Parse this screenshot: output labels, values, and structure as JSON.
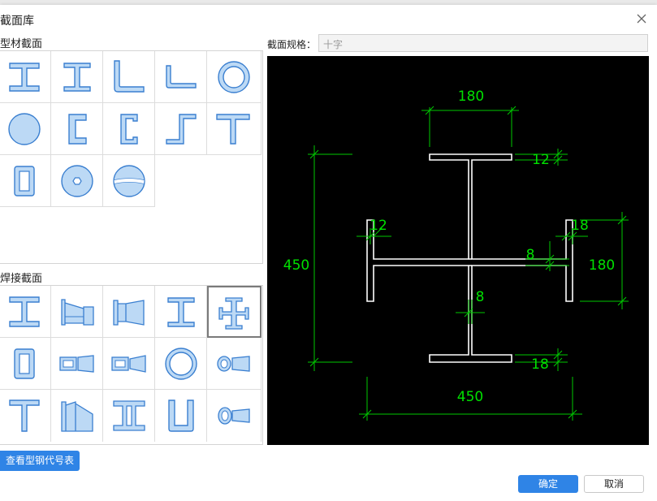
{
  "dialog": {
    "title": "截面库",
    "close_icon": "close-icon"
  },
  "profile_section": {
    "label": "型材截面",
    "items": [
      {
        "icon": "i-beam-icon"
      },
      {
        "icon": "h-beam-icon"
      },
      {
        "icon": "unequal-angle-icon"
      },
      {
        "icon": "equal-angle-icon"
      },
      {
        "icon": "circular-tube-icon"
      },
      {
        "icon": "solid-round-icon"
      },
      {
        "icon": "channel-icon"
      },
      {
        "icon": "lipped-channel-icon"
      },
      {
        "icon": "z-section-icon"
      },
      {
        "icon": "t-section-icon"
      },
      {
        "icon": "rectangular-tube-icon"
      },
      {
        "icon": "hexagon-hole-round-icon"
      },
      {
        "icon": "grooved-round-icon"
      }
    ]
  },
  "welded_section": {
    "label": "焊接截面",
    "selected_index": 4,
    "items": [
      {
        "icon": "welded-i-beam-icon"
      },
      {
        "icon": "tapered-i-beam-icon"
      },
      {
        "icon": "tapered-i-beam-reverse-icon"
      },
      {
        "icon": "welded-h-beam-icon"
      },
      {
        "icon": "cross-section-icon"
      },
      {
        "icon": "welded-box-icon"
      },
      {
        "icon": "box-tapered-icon"
      },
      {
        "icon": "box-tapered-reverse-icon"
      },
      {
        "icon": "welded-tube-icon"
      },
      {
        "icon": "tube-tapered-icon"
      },
      {
        "icon": "welded-t-icon"
      },
      {
        "icon": "tapered-t-icon"
      },
      {
        "icon": "double-channel-icon"
      },
      {
        "icon": "u-section-icon"
      },
      {
        "icon": "tube-tapered-reverse-icon"
      }
    ]
  },
  "spec": {
    "label": "截面规格：",
    "value": "十字"
  },
  "drawing": {
    "dims": {
      "top_width": "180",
      "top_flange_thk": "12",
      "height": "450",
      "left_flange_thk": "12",
      "right_flange_thk": "18",
      "right_height": "180",
      "horizontal_web_thk": "8",
      "vertical_web_thk": "8",
      "bottom_flange_thk": "18",
      "bottom_width": "450"
    },
    "colors": {
      "background": "#000000",
      "outline": "#ffffff",
      "dimension": "#00e000"
    }
  },
  "buttons": {
    "view_code_table": "查看型钢代号表",
    "ok": "确定",
    "cancel": "取消"
  },
  "colors": {
    "accent": "#2f84e6",
    "icon_fill": "#bcd9f5",
    "icon_stroke": "#3a7fd0"
  }
}
